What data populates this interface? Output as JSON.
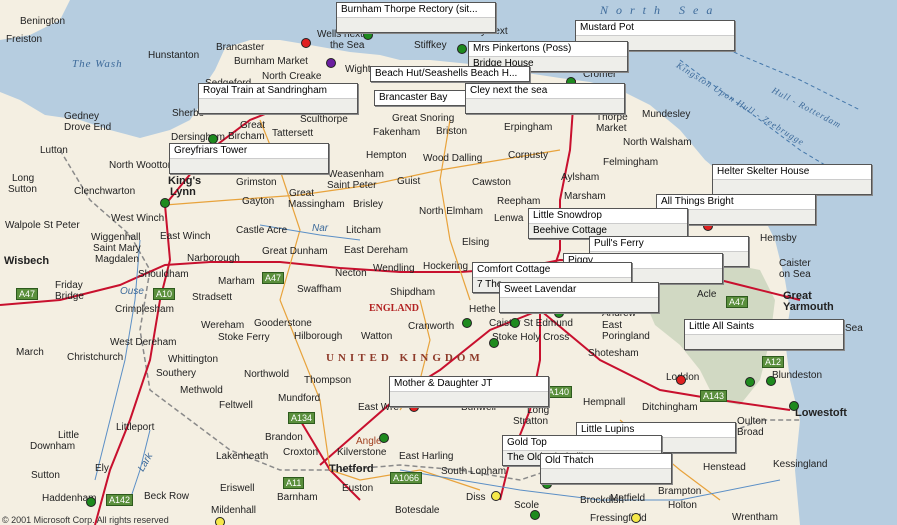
{
  "map": {
    "copyright": "© 2001 Microsoft Corp. All rights reserved",
    "colors": {
      "land": "#f4efe2",
      "sea": "#b6cde0",
      "marsh": "#cdd6c0",
      "road": "#c8102e",
      "minor_road": "#e8a33c",
      "border": "#888",
      "pin_green": "#1e8a1e",
      "pin_red": "#e02020",
      "pin_purple": "#6a1ea0",
      "pin_yellow": "#f5e84a"
    },
    "water_labels": [
      {
        "id": "the-wash",
        "text": "The Wash"
      },
      {
        "id": "north-sea",
        "text": "North Sea"
      },
      {
        "id": "ferry-route",
        "text": "Kingston Upon Hull - Zeebrugge"
      },
      {
        "id": "ferry-route2",
        "text": "Hull - Rotterdam"
      }
    ],
    "region_labels": {
      "country": "UNITED KINGDOM",
      "england": "ENGLAND"
    },
    "roads": [
      "A47",
      "A10",
      "A47",
      "A134",
      "A11",
      "A1066",
      "A140",
      "A143",
      "A142",
      "A12",
      "A47"
    ],
    "places": [
      {
        "id": "benington",
        "text": "Benington"
      },
      {
        "id": "freiston",
        "text": "Freiston"
      },
      {
        "id": "hunstanton",
        "text": "Hunstanton"
      },
      {
        "id": "brancaster",
        "text": "Brancaster"
      },
      {
        "id": "wells",
        "text": "Wells next"
      },
      {
        "id": "the-sea",
        "text": "the Sea"
      },
      {
        "id": "stiffkey",
        "text": "Stiffkey"
      },
      {
        "id": "cley",
        "text": "Cley next"
      },
      {
        "id": "burnham-market",
        "text": "Burnham Market"
      },
      {
        "id": "wighton",
        "text": "Wighto"
      },
      {
        "id": "north-creake",
        "text": "North Creake"
      },
      {
        "id": "sedgeford",
        "text": "Sedgeford"
      },
      {
        "id": "cromer",
        "text": "Cromer"
      },
      {
        "id": "sherbourne",
        "text": "Sherbo"
      },
      {
        "id": "gedney",
        "text": "Gedney"
      },
      {
        "id": "drove-end",
        "text": "Drove End"
      },
      {
        "id": "dersingham",
        "text": "Dersingham"
      },
      {
        "id": "great-bircham",
        "text": "Great"
      },
      {
        "id": "bircham",
        "text": "Bircham"
      },
      {
        "id": "tattersett",
        "text": "Tattersett"
      },
      {
        "id": "sculthorpe",
        "text": "Sculthorpe"
      },
      {
        "id": "great-snoring",
        "text": "Great Snoring"
      },
      {
        "id": "fakenham",
        "text": "Fakenham"
      },
      {
        "id": "briston",
        "text": "Briston"
      },
      {
        "id": "erpingham",
        "text": "Erpingham"
      },
      {
        "id": "thorpe-market",
        "text": "Thorpe"
      },
      {
        "id": "market",
        "text": "Market"
      },
      {
        "id": "mundesley",
        "text": "Mundesley"
      },
      {
        "id": "north-walsham",
        "text": "North Walsham"
      },
      {
        "id": "lutton",
        "text": "Lutton"
      },
      {
        "id": "north-wootton",
        "text": "North Wootton"
      },
      {
        "id": "kings-lynn",
        "text": "King's"
      },
      {
        "id": "lynn",
        "text": "Lynn"
      },
      {
        "id": "hempton",
        "text": "Hempton"
      },
      {
        "id": "wood-dalling",
        "text": "Wood Dalling"
      },
      {
        "id": "corpusty",
        "text": "Corpusty"
      },
      {
        "id": "felmingham",
        "text": "Felmingham"
      },
      {
        "id": "long-sutton",
        "text": "Long"
      },
      {
        "id": "sutton",
        "text": "Sutton"
      },
      {
        "id": "clenchwarton",
        "text": "Clenchwarton"
      },
      {
        "id": "grimston",
        "text": "Grimston"
      },
      {
        "id": "weasenham",
        "text": "Weasenham"
      },
      {
        "id": "saint-peter",
        "text": "Saint Peter"
      },
      {
        "id": "guist",
        "text": "Guist"
      },
      {
        "id": "cawston",
        "text": "Cawston"
      },
      {
        "id": "aylsham",
        "text": "Aylsham"
      },
      {
        "id": "marsham",
        "text": "Marsham"
      },
      {
        "id": "gayton",
        "text": "Gayton"
      },
      {
        "id": "great-massingham",
        "text": "Great"
      },
      {
        "id": "massingham",
        "text": "Massingham"
      },
      {
        "id": "brisley",
        "text": "Brisley"
      },
      {
        "id": "reepham",
        "text": "Reepham"
      },
      {
        "id": "walpole",
        "text": "Walpole St Peter"
      },
      {
        "id": "west-winch",
        "text": "West Winch"
      },
      {
        "id": "north-elmham",
        "text": "North Elmham"
      },
      {
        "id": "lenwade",
        "text": "Lenwa"
      },
      {
        "id": "wiggenhall",
        "text": "Wiggenhall"
      },
      {
        "id": "saint-mary",
        "text": "Saint Mary"
      },
      {
        "id": "magdalen",
        "text": "Magdalen"
      },
      {
        "id": "east-winch",
        "text": "East Winch"
      },
      {
        "id": "castle-acre",
        "text": "Castle Acre"
      },
      {
        "id": "nar",
        "text": "Nar"
      },
      {
        "id": "litcham",
        "text": "Litcham"
      },
      {
        "id": "elsing",
        "text": "Elsing"
      },
      {
        "id": "hemsby",
        "text": "Hemsby"
      },
      {
        "id": "wisbech",
        "text": "Wisbech"
      },
      {
        "id": "narborough",
        "text": "Narborough"
      },
      {
        "id": "great-dunham",
        "text": "Great Dunham"
      },
      {
        "id": "east-dereham",
        "text": "East Dereham"
      },
      {
        "id": "wendling",
        "text": "Wendling"
      },
      {
        "id": "hockering",
        "text": "Hockering"
      },
      {
        "id": "caister",
        "text": "Caister"
      },
      {
        "id": "on-sea",
        "text": "on Sea"
      },
      {
        "id": "shouldham",
        "text": "Shouldham"
      },
      {
        "id": "marham",
        "text": "Marham"
      },
      {
        "id": "necton",
        "text": "Necton"
      },
      {
        "id": "friday-bridge",
        "text": "Friday"
      },
      {
        "id": "bridge",
        "text": "Bridge"
      },
      {
        "id": "ouse",
        "text": "Ouse"
      },
      {
        "id": "stradsett",
        "text": "Stradsett"
      },
      {
        "id": "swaffham",
        "text": "Swaffham"
      },
      {
        "id": "shipdham",
        "text": "Shipdham"
      },
      {
        "id": "acle",
        "text": "Acle"
      },
      {
        "id": "great-yarmouth",
        "text": "Great"
      },
      {
        "id": "yarmouth",
        "text": "Yarmouth"
      },
      {
        "id": "crimplesham",
        "text": "Crimplesham"
      },
      {
        "id": "hethersett",
        "text": "Hethe"
      },
      {
        "id": "caistor-st-edmund",
        "text": "Caistor St Edmund"
      },
      {
        "id": "andrew",
        "text": "Andrew"
      },
      {
        "id": "east-poringland",
        "text": "East"
      },
      {
        "id": "poringland",
        "text": "Poringland"
      },
      {
        "id": "wereham",
        "text": "Wereham"
      },
      {
        "id": "gooderstone",
        "text": "Gooderstone"
      },
      {
        "id": "stoke-ferry",
        "text": "Stoke Ferry"
      },
      {
        "id": "cranworth",
        "text": "Cranworth"
      },
      {
        "id": "stoke-holy-cross",
        "text": "Stoke Holy Cross"
      },
      {
        "id": "sea",
        "text": "Sea"
      },
      {
        "id": "march",
        "text": "March"
      },
      {
        "id": "west-dereham",
        "text": "West Dereham"
      },
      {
        "id": "hilborough",
        "text": "Hilborough"
      },
      {
        "id": "watton",
        "text": "Watton"
      },
      {
        "id": "shotesham",
        "text": "Shotesham"
      },
      {
        "id": "christchurch",
        "text": "Christchurch"
      },
      {
        "id": "whittington",
        "text": "Whittington"
      },
      {
        "id": "southery",
        "text": "Southery"
      },
      {
        "id": "northwold",
        "text": "Northwold"
      },
      {
        "id": "thompson",
        "text": "Thompson"
      },
      {
        "id": "loddon",
        "text": "Loddon"
      },
      {
        "id": "blundeston",
        "text": "Blundeston"
      },
      {
        "id": "methwold",
        "text": "Methwold"
      },
      {
        "id": "mundford",
        "text": "Mundford"
      },
      {
        "id": "hempnall",
        "text": "Hempnall"
      },
      {
        "id": "feltwell",
        "text": "Feltwell"
      },
      {
        "id": "east-wretham",
        "text": "East Wre"
      },
      {
        "id": "bunwell",
        "text": "Bunwell"
      },
      {
        "id": "ditchingham",
        "text": "Ditchingham"
      },
      {
        "id": "lowestoft",
        "text": "Lowestoft"
      },
      {
        "id": "littleport",
        "text": "Littleport"
      },
      {
        "id": "long-stratton",
        "text": "Long"
      },
      {
        "id": "stratton",
        "text": "Stratton"
      },
      {
        "id": "oulton-broad",
        "text": "Oulton"
      },
      {
        "id": "broad",
        "text": "Broad"
      },
      {
        "id": "little-downham",
        "text": "Little"
      },
      {
        "id": "downham",
        "text": "Downham"
      },
      {
        "id": "brandon",
        "text": "Brandon"
      },
      {
        "id": "croxton",
        "text": "Croxton"
      },
      {
        "id": "kilverstone",
        "text": "Kilverstone"
      },
      {
        "id": "angle",
        "text": "Angle"
      },
      {
        "id": "lakenheath",
        "text": "Lakenheath"
      },
      {
        "id": "east-harling",
        "text": "East Harling"
      },
      {
        "id": "henstead",
        "text": "Henstead"
      },
      {
        "id": "ely",
        "text": "Ely"
      },
      {
        "id": "lark",
        "text": "Lark"
      },
      {
        "id": "thetford",
        "text": "Thetford"
      },
      {
        "id": "south-lopham",
        "text": "South Lopham"
      },
      {
        "id": "kessingland",
        "text": "Kessingland"
      },
      {
        "id": "sutton-ely",
        "text": "Sutton"
      },
      {
        "id": "eriswell",
        "text": "Eriswell"
      },
      {
        "id": "euston",
        "text": "Euston"
      },
      {
        "id": "brampton",
        "text": "Brampton"
      },
      {
        "id": "haddenham",
        "text": "Haddenham"
      },
      {
        "id": "beck-row",
        "text": "Beck Row"
      },
      {
        "id": "barnham",
        "text": "Barnham"
      },
      {
        "id": "diss",
        "text": "Diss"
      },
      {
        "id": "brockdish",
        "text": "Brockdish"
      },
      {
        "id": "metfield",
        "text": "Metfield"
      },
      {
        "id": "holton",
        "text": "Holton"
      },
      {
        "id": "mildenhall",
        "text": "Mildenhall"
      },
      {
        "id": "botesdale",
        "text": "Botesdale"
      },
      {
        "id": "scole",
        "text": "Scole"
      },
      {
        "id": "fressingfield",
        "text": "Fressingfield"
      },
      {
        "id": "wrentham",
        "text": "Wrentham"
      },
      {
        "id": "burnham-market-hidden",
        "text": "Burnham"
      }
    ],
    "callouts": [
      {
        "id": "burnham-thorpe-rectory",
        "title": "Burnham Thorpe Rectory (sit...",
        "sub": ""
      },
      {
        "id": "mustard-pot",
        "title": "Mustard Pot",
        "sub": ""
      },
      {
        "id": "mrs-pinkertons",
        "title": "Mrs Pinkertons (Poss)",
        "sub": "Bridge House"
      },
      {
        "id": "beach-hut",
        "title": "Beach Hut/Seashells Beach H...",
        "sub": ""
      },
      {
        "id": "royal-train",
        "title": "Royal Train at Sandringham",
        "sub": ""
      },
      {
        "id": "brancaster-bay",
        "title": "Brancaster Bay",
        "sub": ""
      },
      {
        "id": "cley-next-the-sea",
        "title": "Cley next the sea",
        "sub": ""
      },
      {
        "id": "greyfriars-tower",
        "title": "Greyfriars Tower",
        "sub": ""
      },
      {
        "id": "helter-skelter",
        "title": "Helter Skelter House",
        "sub": ""
      },
      {
        "id": "all-things-bright",
        "title": "All Things Bright",
        "sub": ""
      },
      {
        "id": "little-snowdrop",
        "title": "Little Snowdrop",
        "sub": "Beehive Cottage"
      },
      {
        "id": "pulls-ferry",
        "title": "Pull's Ferry",
        "sub": ""
      },
      {
        "id": "piggy",
        "title": "Piggy",
        "sub": ""
      },
      {
        "id": "comfort-cottage",
        "title": "Comfort Cottage",
        "sub": "7 The"
      },
      {
        "id": "sweet-lavendar",
        "title": "Sweet Lavendar",
        "sub": ""
      },
      {
        "id": "little-all-saints",
        "title": "Little All Saints",
        "sub": ""
      },
      {
        "id": "mother-daughter",
        "title": "Mother & Daughter JT",
        "sub": ""
      },
      {
        "id": "little-lupins",
        "title": "Little Lupins",
        "sub": ""
      },
      {
        "id": "gold-top",
        "title": "Gold Top",
        "sub": "The Old Windmill"
      },
      {
        "id": "old-thatch",
        "title": "Old Thatch",
        "sub": ""
      }
    ],
    "pins": [
      {
        "id": "pin-wells",
        "color": "pin_red"
      },
      {
        "id": "pin-burnham-thorpe",
        "color": "pin_green"
      },
      {
        "id": "pin-wighton",
        "color": "pin_purple"
      },
      {
        "id": "pin-stiffkey",
        "color": "pin_green"
      },
      {
        "id": "pin-cley",
        "color": "pin_red"
      },
      {
        "id": "pin-cromer",
        "color": "pin_green"
      },
      {
        "id": "pin-sandringham",
        "color": "pin_green"
      },
      {
        "id": "pin-kings-lynn",
        "color": "pin_green"
      },
      {
        "id": "pin-helter-skelter",
        "color": "pin_red"
      },
      {
        "id": "pin-norwich",
        "color": "pin_green"
      },
      {
        "id": "pin-hethersett",
        "color": "pin_green"
      },
      {
        "id": "pin-caistor",
        "color": "pin_green"
      },
      {
        "id": "pin-stoke",
        "color": "pin_green"
      },
      {
        "id": "pin-loddon",
        "color": "pin_red"
      },
      {
        "id": "pin-broads1",
        "color": "pin_green"
      },
      {
        "id": "pin-broads2",
        "color": "pin_green"
      },
      {
        "id": "pin-lowestoft",
        "color": "pin_green"
      },
      {
        "id": "pin-east-wretham",
        "color": "pin_red"
      },
      {
        "id": "pin-kilverstone",
        "color": "pin_green"
      },
      {
        "id": "pin-diss",
        "color": "pin_yellow"
      },
      {
        "id": "pin-scole",
        "color": "pin_green"
      },
      {
        "id": "pin-fressingfield",
        "color": "pin_yellow"
      },
      {
        "id": "pin-haddenham",
        "color": "pin_green"
      },
      {
        "id": "pin-mildenhall",
        "color": "pin_yellow"
      },
      {
        "id": "pin-dickleburgh",
        "color": "pin_green"
      }
    ]
  }
}
